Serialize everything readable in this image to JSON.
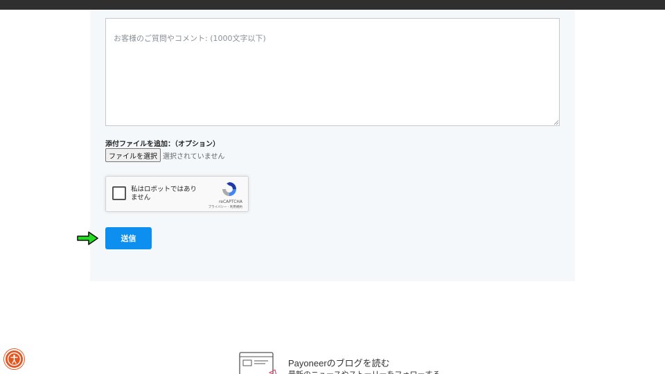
{
  "form": {
    "comment_placeholder": "お客様のご質問やコメント: (1000文字以下)",
    "attachment_label": "添付ファイルを追加：（オプション）",
    "file_button_label": "ファイルを選択",
    "file_status": "選択されていません",
    "submit_label": "送信"
  },
  "recaptcha": {
    "checkbox_label": "私はロボットではありません",
    "brand": "reCAPTCHA",
    "links": "プライバシー - 利用規約"
  },
  "footer": {
    "blog_title": "Payoneerのブログを読む",
    "blog_subtitle": "最新のニュースやストーリーをフォローする"
  },
  "colors": {
    "accent_blue": "#0d8ff0",
    "panel_background": "#f5f8fb",
    "arrow_green": "#22dd22",
    "accessibility_orange": "#e8541e"
  }
}
